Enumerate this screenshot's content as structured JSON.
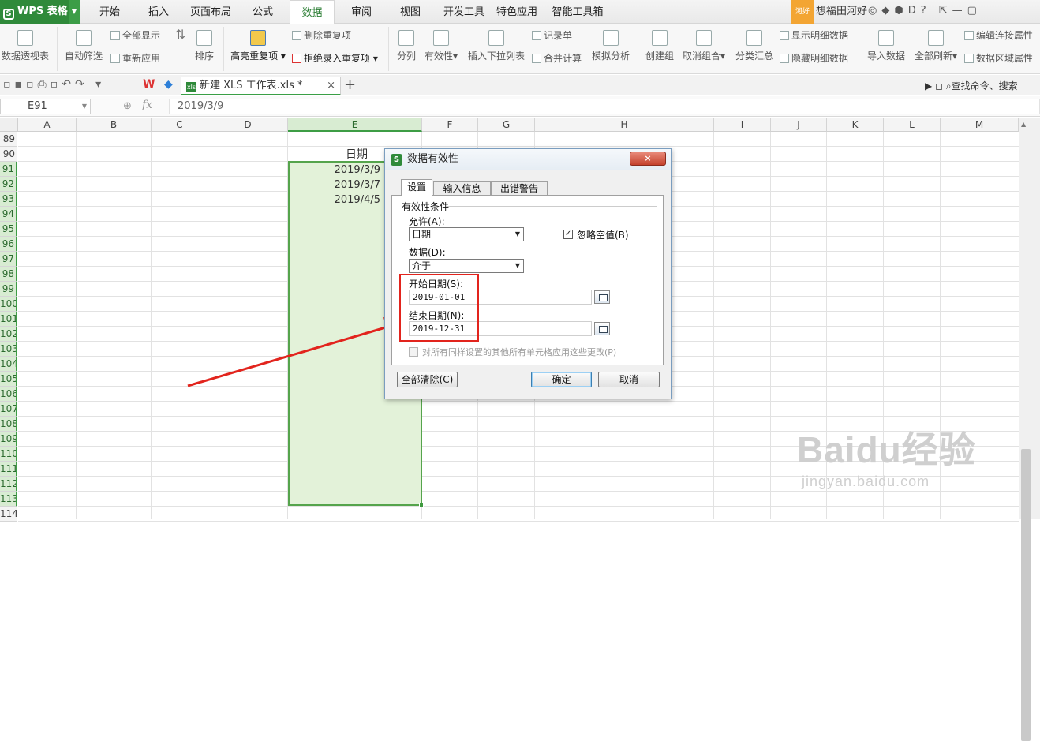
{
  "app": {
    "logo": "S",
    "name": "WPS 表格"
  },
  "menu_tabs": [
    "开始",
    "插入",
    "页面布局",
    "公式",
    "数据",
    "审阅",
    "视图",
    "开发工具",
    "特色应用",
    "智能工具箱"
  ],
  "active_tab": "数据",
  "user": {
    "tag": "河好",
    "name": "想福田河好"
  },
  "ribbon": {
    "pivot": "数据透视表",
    "autofilter": "自动筛选",
    "show_all": "全部显示",
    "reapply": "重新应用",
    "sort": "排序",
    "highlight_dup": "高亮重复项",
    "delete_dup": "删除重复项",
    "reject_dup": "拒绝录入重复项",
    "split": "分列",
    "validity": "有效性",
    "insert_dropdown": "插入下拉列表",
    "record": "记录单",
    "merge_calc": "合并计算",
    "simulate": "模拟分析",
    "create_group": "创建组",
    "ungroup": "取消组合",
    "subtotal": "分类汇总",
    "show_detail": "显示明细数据",
    "hide_detail": "隐藏明细数据",
    "import": "导入数据",
    "refresh_all": "全部刷新",
    "edit_link": "编辑连接属性",
    "data_area": "数据区域属性"
  },
  "file_tab": {
    "icon": "xls",
    "name": "新建 XLS 工作表.xls *",
    "close": "×",
    "add": "+"
  },
  "search_cmd": "查找命令、搜索",
  "formula_bar": {
    "name_box": "E91",
    "fx": "fx",
    "content": "2019/3/9"
  },
  "columns": [
    "A",
    "B",
    "C",
    "D",
    "E",
    "F",
    "G",
    "H",
    "I",
    "J",
    "K",
    "L",
    "M"
  ],
  "selected_column": "E",
  "rows": [
    "89",
    "90",
    "91",
    "92",
    "93",
    "94",
    "95",
    "96",
    "97",
    "98",
    "99",
    "100",
    "101",
    "102",
    "103",
    "104",
    "105",
    "106",
    "107",
    "108",
    "109",
    "110",
    "111",
    "112",
    "113",
    "114"
  ],
  "cells": {
    "header": "日期",
    "dates": [
      "2019/3/9",
      "2019/3/7",
      "2019/4/5"
    ]
  },
  "dialog": {
    "title": "数据有效性",
    "close": "×",
    "tabs": [
      "设置",
      "输入信息",
      "出错警告"
    ],
    "section": "有效性条件",
    "allow_label": "允许(A):",
    "allow_value": "日期",
    "ignore_blank": "忽略空值(B)",
    "ignore_blank_checked": true,
    "data_label": "数据(D):",
    "data_value": "介于",
    "start_label": "开始日期(S):",
    "start_value": "2019-01-01",
    "end_label": "结束日期(N):",
    "end_value": "2019-12-31",
    "apply_all": "对所有同样设置的其他所有单元格应用这些更改(P)",
    "clear_all": "全部清除(C)",
    "ok": "确定",
    "cancel": "取消"
  },
  "colors": {
    "accent": "#2f8a3a",
    "selection_fill": "#e3f2d9",
    "selection_border": "#55a44c",
    "annotation": "#e2241d"
  },
  "watermark": {
    "brand": "Baidu经验",
    "url": "jingyan.baidu.com"
  }
}
